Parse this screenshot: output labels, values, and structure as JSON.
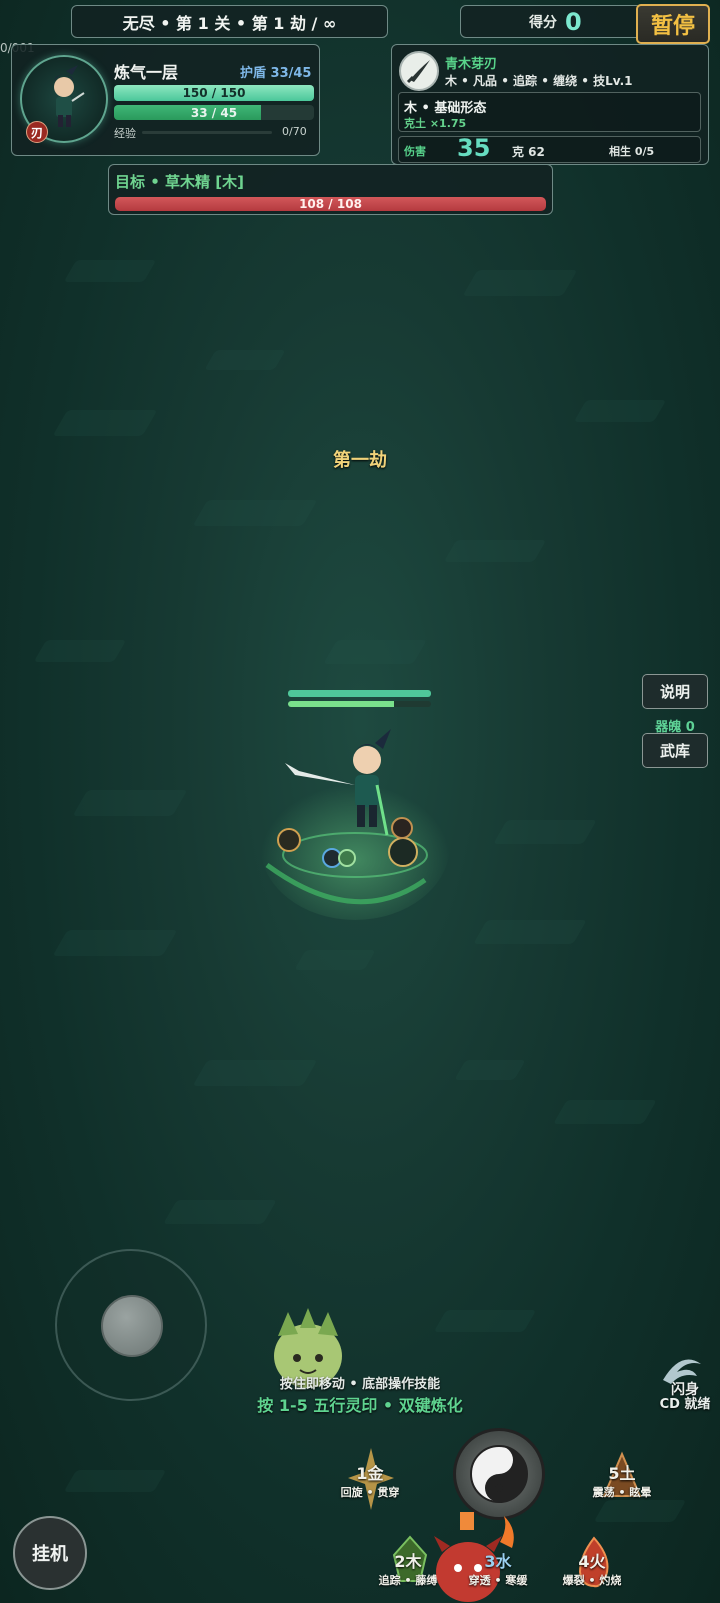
{
  "hud": {
    "stage_text": "无尽 • 第 1 关 • 第 1 劫 / ∞",
    "score_label": "得分",
    "score_value": "0",
    "pause_label": "暂停",
    "corner_text": "0/001"
  },
  "player": {
    "realm": "炼气一层",
    "shield_text": "护盾 33/45",
    "hp_text": "150 / 150",
    "hp_fraction": 1.0,
    "mp_text": "33 / 45",
    "mp_fraction": 0.733,
    "exp_label": "经验",
    "exp_value": "0/70",
    "exp_fraction": 0.0,
    "badge": "刃"
  },
  "weapon": {
    "name": "青木芽刃",
    "tags": "木 • 凡品 • 追踪 • 缠绕 • 技Lv.1",
    "form_name": "木 • 基础形态",
    "counter_text": "克土 ×1.75",
    "damage_label": "伤害",
    "damage_value": "35",
    "counter_value": "克 62",
    "generate_value": "相生 0/5"
  },
  "target": {
    "label": "目标 • 草木精 [木]",
    "hp_text": "108 / 108",
    "hp_fraction": 1.0
  },
  "wave_text": "第一劫",
  "side": {
    "explain_label": "说明",
    "soul_label": "器魄 0",
    "armory_label": "武库"
  },
  "hero_bars": {
    "hp_fraction": 1.0,
    "mp_fraction": 0.74
  },
  "hints": {
    "move": "按住即移动 • 底部操作技能",
    "keys": "按 1-5 五行灵印 • 双键炼化"
  },
  "skills": [
    {
      "num": "1金",
      "label": "回旋 • 贯穿",
      "color": "#c9a85a"
    },
    {
      "num": "2木",
      "label": "追踪 • 藤缚",
      "color": "#6cbf5a"
    },
    {
      "num": "3水",
      "label": "穿透 • 寒缓",
      "color": "#5aa8e0"
    },
    {
      "num": "4火",
      "label": "爆裂 • 灼烧",
      "color": "#e0603a"
    },
    {
      "num": "5土",
      "label": "震荡 • 眩晕",
      "color": "#b57a3a"
    }
  ],
  "dodge": {
    "label": "闪身",
    "status": "CD 就绪"
  },
  "idle_label": "挂机",
  "colors": {
    "accent_green": "#5fd490",
    "pause_gold": "#f3c043",
    "wave_gold": "#f1d37a",
    "target_red": "#c0444a"
  }
}
